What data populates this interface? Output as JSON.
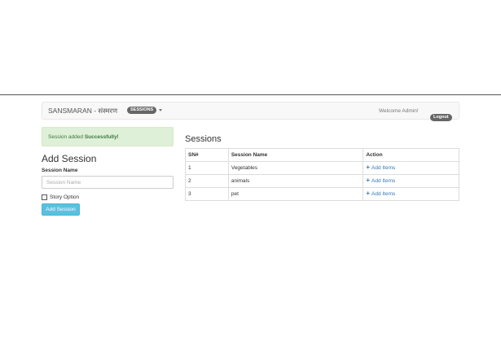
{
  "navbar": {
    "brand": "SANSMARAN - संस्मरण",
    "sessions_label": "SESSIONS",
    "welcome": "Welcome Admin!",
    "logout_label": "Logout"
  },
  "alert": {
    "prefix": "Session added ",
    "strong": "Successfully!"
  },
  "form": {
    "title": "Add Session",
    "session_name_label": "Session Name",
    "session_name_placeholder": "Session Name",
    "session_name_value": "",
    "story_option_label": "Story Option",
    "story_option_checked": false,
    "submit_label": "Add Session"
  },
  "sessions": {
    "title": "Sessions",
    "columns": [
      "SN#",
      "Session Name",
      "Action"
    ],
    "rows": [
      {
        "sn": "1",
        "name": "Vegetables",
        "action": "Add Items"
      },
      {
        "sn": "2",
        "name": "animals",
        "action": "Add Items"
      },
      {
        "sn": "3",
        "name": "pet",
        "action": "Add Items"
      }
    ]
  },
  "colors": {
    "alert_bg": "#dff0d8",
    "alert_text": "#3c763d",
    "info_button": "#5bc0de",
    "link": "#337ab7",
    "pill": "#666666"
  },
  "icons": {
    "add_action": "plus-icon",
    "dropdown": "caret-down-icon"
  }
}
